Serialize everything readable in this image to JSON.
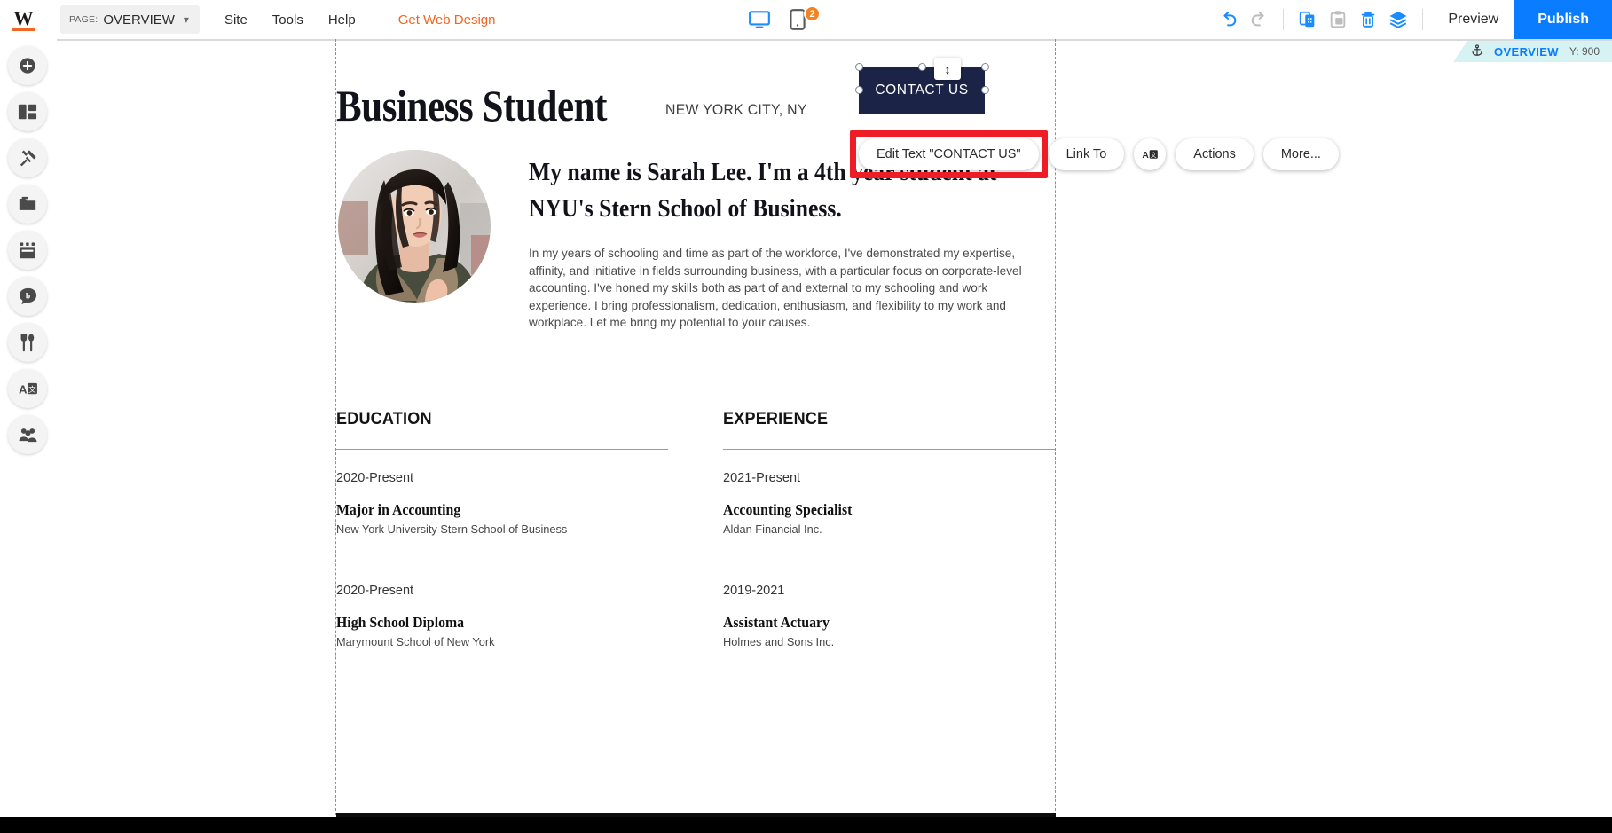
{
  "topbar": {
    "logo": "W",
    "page_label": "PAGE:",
    "page_name": "OVERVIEW",
    "menus": [
      "Site",
      "Tools",
      "Help"
    ],
    "promo": "Get Web Design",
    "desktop_icon": "desktop-icon",
    "mobile_icon": "mobile-icon",
    "mobile_badge": "2",
    "undo_icon": "undo-icon",
    "redo_icon": "redo-icon",
    "copy_icon": "copy-icon",
    "paste_icon": "paste-icon",
    "delete_icon": "trash-icon",
    "layers_icon": "layers-icon",
    "preview": "Preview",
    "publish": "Publish"
  },
  "ribbon": {
    "anchor_icon": "anchor-icon",
    "name": "OVERVIEW",
    "position": "Y: 900"
  },
  "sidebar": {
    "items": [
      {
        "name": "add",
        "icon": "plus-circle-icon"
      },
      {
        "name": "sections",
        "icon": "layout-blocks-icon"
      },
      {
        "name": "design",
        "icon": "paint-tools-icon"
      },
      {
        "name": "media",
        "icon": "folder-icon"
      },
      {
        "name": "store",
        "icon": "storefront-icon"
      },
      {
        "name": "blog",
        "icon": "blog-bubble-icon"
      },
      {
        "name": "restaurant",
        "icon": "fork-spoon-icon"
      },
      {
        "name": "translate",
        "icon": "translate-icon"
      },
      {
        "name": "members",
        "icon": "members-icon"
      }
    ]
  },
  "context_toolbar": {
    "edit_text": "Edit Text \"CONTACT US\"",
    "link_to": "Link To",
    "translate_icon": "translate-icon",
    "actions": "Actions",
    "more": "More...",
    "resize_handle_icon": "vertical-resize-icon",
    "highlight_color": "#ee1c25"
  },
  "site": {
    "hero": {
      "title": "Business Student",
      "location": "NEW YORK CITY, NY",
      "button_label": "CONTACT US",
      "button_color": "#1b2447"
    },
    "profile_photo_alt": "profile-photo",
    "intro": {
      "headline": "My name is Sarah Lee. I'm a 4th year student at NYU's Stern School of Business.",
      "body": "In my years of schooling and time as part of the workforce, I've demonstrated my expertise, affinity, and initiative in fields surrounding business, with a particular focus on corporate-level accounting. I've honed my skills both as part of and external to my schooling and work experience. I bring professionalism, dedication, enthusiasm, and flexibility to my work and workplace. Let me bring my potential to your causes."
    },
    "columns": [
      {
        "heading": "EDUCATION",
        "entries": [
          {
            "date": "2020-Present",
            "title": "Major in Accounting",
            "org": "New York University Stern School of Business"
          },
          {
            "date": "2020-Present",
            "title": "High School Diploma",
            "org": "Marymount School of New York"
          }
        ]
      },
      {
        "heading": "EXPERIENCE",
        "entries": [
          {
            "date": "2021-Present",
            "title": "Accounting Specialist",
            "org": "Aldan Financial Inc."
          },
          {
            "date": "2019-2021",
            "title": "Assistant Actuary",
            "org": "Holmes and Sons Inc."
          }
        ]
      }
    ]
  }
}
